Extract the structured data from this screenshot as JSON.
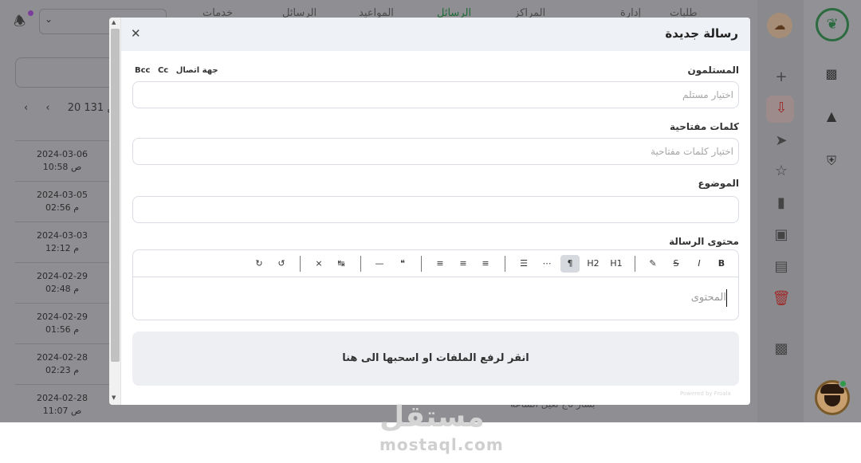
{
  "background": {
    "top_nav": [
      "خدمات",
      "الرسائل",
      "المواعيد",
      "الرسائل",
      "المراكز",
      "إدارة",
      "طلبات"
    ],
    "top_nav_active_index": 3,
    "select_value": "",
    "pager_text": "20 من 131",
    "dates": [
      {
        "date": "2024-03-06",
        "time": "10:58 ص"
      },
      {
        "date": "2024-03-05",
        "time": "02:56 م"
      },
      {
        "date": "2024-03-03",
        "time": "12:12 م"
      },
      {
        "date": "2024-02-29",
        "time": "02:48 م"
      },
      {
        "date": "2024-02-29",
        "time": "01:56 م"
      },
      {
        "date": "2024-02-28",
        "time": "02:23 م"
      },
      {
        "date": "2024-02-28",
        "time": "11:07 ص"
      }
    ],
    "bottom_row_text": "بشار تاج تعيل   الساعة"
  },
  "modal": {
    "title": "رسالة جديدة",
    "recipients": {
      "label": "المستلمون",
      "placeholder": "اختيار مستلم",
      "contact_link": "جهة اتصال",
      "cc": "Cc",
      "bcc": "Bcc"
    },
    "keywords": {
      "label": "كلمات مفتاحية",
      "placeholder": "اختيار كلمات مفتاحية"
    },
    "subject": {
      "label": "الموضوع",
      "value": ""
    },
    "content": {
      "label": "محتوى الرسالة",
      "placeholder": "المحتوى"
    },
    "toolbar": {
      "bold": "B",
      "italic": "I",
      "strike": "S",
      "h1": "H1",
      "h2": "H2",
      "paragraph": "¶"
    },
    "dropzone_text": "انقر لرفع الملفات او اسحبها الى هنا",
    "powered_text": "Powered by Froala"
  },
  "watermark": {
    "arabic": "مستقل",
    "latin": "mostaql.com"
  }
}
